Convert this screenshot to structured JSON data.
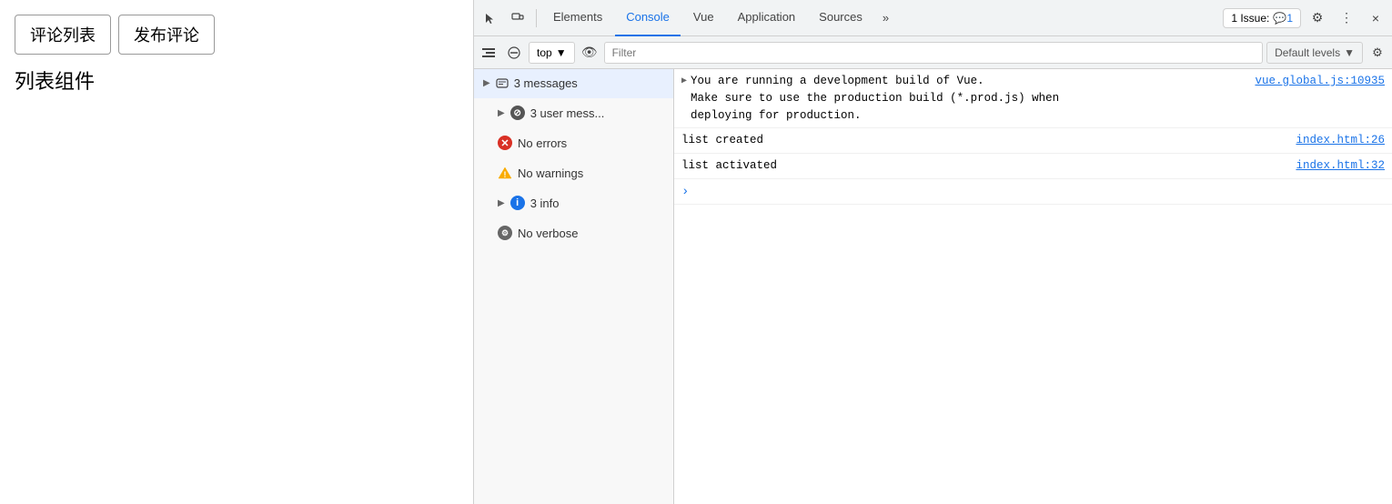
{
  "left_panel": {
    "buttons": [
      {
        "label": "评论列表",
        "name": "comment-list-button"
      },
      {
        "label": "发布评论",
        "name": "publish-comment-button"
      }
    ],
    "title": "列表组件"
  },
  "devtools": {
    "tabs": [
      {
        "label": "Elements",
        "active": false
      },
      {
        "label": "Console",
        "active": true
      },
      {
        "label": "Vue",
        "active": false
      },
      {
        "label": "Application",
        "active": false
      },
      {
        "label": "Sources",
        "active": false
      }
    ],
    "tab_more": "»",
    "issue_badge": "1 Issue:",
    "close_label": "×",
    "console_toolbar": {
      "top_label": "top",
      "filter_placeholder": "Filter",
      "default_levels_label": "Default levels"
    },
    "sidebar": {
      "items": [
        {
          "icon": "messages",
          "label": "3 messages",
          "has_arrow": true,
          "active": true
        },
        {
          "icon": "user",
          "label": "3 user mess...",
          "has_arrow": true
        },
        {
          "icon": "error",
          "label": "No errors"
        },
        {
          "icon": "warning",
          "label": "No warnings"
        },
        {
          "icon": "info",
          "label": "3 info",
          "has_arrow": true
        },
        {
          "icon": "verbose",
          "label": "No verbose"
        }
      ]
    },
    "output": {
      "entries": [
        {
          "type": "expand",
          "content": "You are running a development build of Vue.\nMake sure to use the production build (*.prod.js) when\ndeploying for production.",
          "link": "vue.global.js:10935"
        },
        {
          "type": "normal",
          "content": "list created",
          "link": "index.html:26"
        },
        {
          "type": "normal",
          "content": "list activated",
          "link": "index.html:32"
        }
      ]
    }
  },
  "colors": {
    "accent_blue": "#1a73e8",
    "error_red": "#d93025",
    "warning_yellow": "#f9ab00",
    "info_blue": "#1a73e8",
    "border": "#d0d0d0"
  }
}
